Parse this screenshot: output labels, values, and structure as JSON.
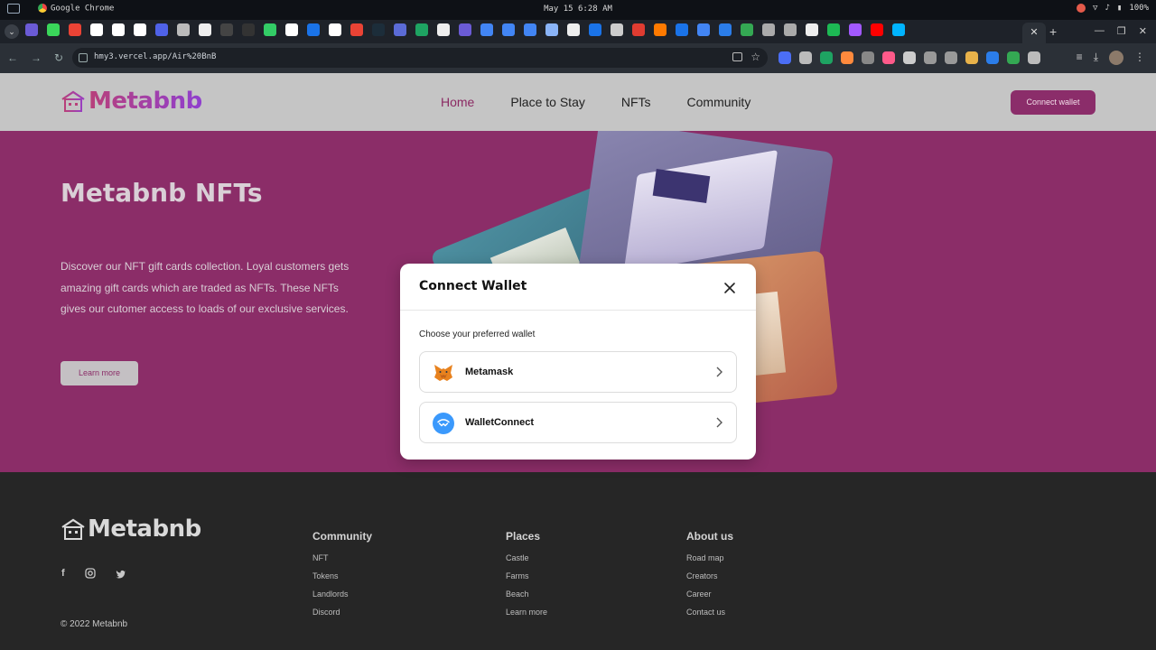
{
  "system_bar": {
    "app_name": "Google Chrome",
    "datetime": "May 15  6:28 AM",
    "battery": "100%"
  },
  "browser": {
    "url": "hmy3.vercel.app/Air%20BnB",
    "tab_favicon_colors": [
      "#6b5bd6",
      "#3ad65a",
      "#ea4335",
      "#ffffff",
      "#ffffff",
      "#ffffff",
      "#4f62e8",
      "#bbbbbb",
      "#eeeeee",
      "#444444",
      "#333333",
      "#33cc66",
      "#ffffff",
      "#1a73e8",
      "#ffffff",
      "#ea4335",
      "#1c2d3a",
      "#5b6bd6",
      "#1ea362",
      "#eeeeee",
      "#6b5bd6",
      "#4285f4",
      "#4285f4",
      "#4285f4",
      "#8ab4f8",
      "#eeeeee",
      "#1a73e8",
      "#cccccc",
      "#e03c31",
      "#ff7a00",
      "#1a73e8",
      "#4285f4",
      "#2b7de9",
      "#34a853",
      "#aaaaaa",
      "#aaaaaa",
      "#eeeeee",
      "#1db954",
      "#a259ff",
      "#ff0000",
      "#00b4ff"
    ],
    "extension_colors": [
      "#4b6ef5",
      "#bbbbbb",
      "#1ea362",
      "#ff8a3d",
      "#888888",
      "#ff5a8a",
      "#cccccc",
      "#999999",
      "#999999",
      "#e8b24a",
      "#2b7de9",
      "#34a853",
      "#bbbbbb"
    ]
  },
  "site": {
    "brand": "Metabnb",
    "nav": {
      "items": [
        {
          "label": "Home",
          "active": true
        },
        {
          "label": "Place to Stay",
          "active": false
        },
        {
          "label": "NFTs",
          "active": false
        },
        {
          "label": "Community",
          "active": false
        }
      ]
    },
    "connect_button": "Connect wallet",
    "hero": {
      "title": "Metabnb NFTs",
      "description": "Discover our NFT gift cards collection. Loyal customers gets amazing gift cards which are traded as NFTs. These NFTs gives our cutomer access to loads of our exclusive services.",
      "learn_more": "Learn more"
    },
    "footer": {
      "brand": "Metabnb",
      "copyright": "© 2022 Metabnb",
      "columns": [
        {
          "title": "Community",
          "links": [
            "NFT",
            "Tokens",
            "Landlords",
            "Discord"
          ]
        },
        {
          "title": "Places",
          "links": [
            "Castle",
            "Farms",
            "Beach",
            "Learn more"
          ]
        },
        {
          "title": "About us",
          "links": [
            "Road map",
            "Creators",
            "Career",
            "Contact us"
          ]
        }
      ]
    }
  },
  "modal": {
    "title": "Connect Wallet",
    "subtitle": "Choose your preferred wallet",
    "wallets": [
      {
        "name": "Metamask",
        "icon": "metamask-fox-icon"
      },
      {
        "name": "WalletConnect",
        "icon": "walletconnect-icon"
      }
    ]
  },
  "colors": {
    "brand_purple": "#8b2d68",
    "header_bg": "#c5c5c5",
    "footer_bg": "#262626",
    "active_nav": "#8b2a63"
  }
}
